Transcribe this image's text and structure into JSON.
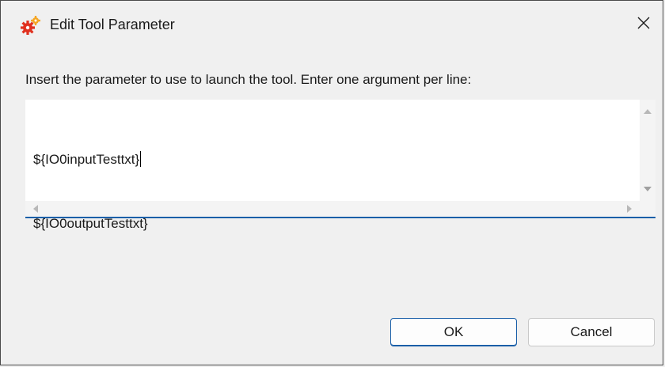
{
  "window": {
    "title": "Edit Tool Parameter",
    "app_icon": "gears-icon",
    "close_icon": "close-icon"
  },
  "instruction": "Insert the parameter to use to launch the tool. Enter one argument per line:",
  "editor": {
    "lines": [
      "${IO0inputTesttxt}",
      "${IO0outputTesttxt}"
    ],
    "focus_color": "#1a5fa8"
  },
  "buttons": {
    "ok_label": "OK",
    "cancel_label": "Cancel"
  },
  "colors": {
    "accent": "#1a5fa8",
    "gear_red": "#e0301e",
    "gear_orange": "#f5a623"
  }
}
